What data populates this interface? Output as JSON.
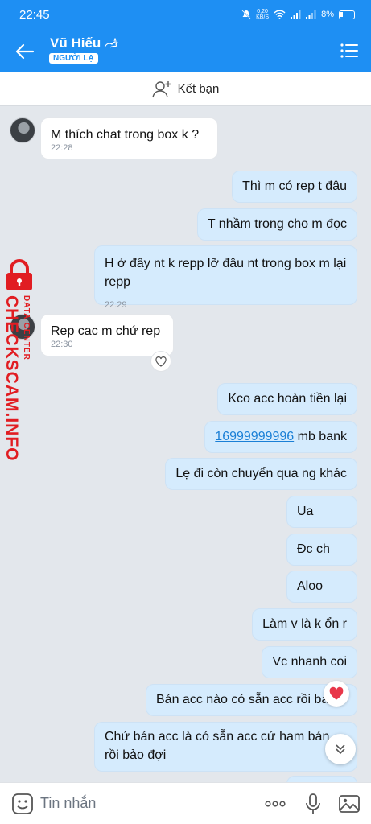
{
  "status": {
    "time": "22:45",
    "net_speed_top": "0,20",
    "net_speed_bottom": "KB/S",
    "battery": "8%"
  },
  "header": {
    "name": "Vũ Hiếu",
    "badge": "NGƯỜI LẠ",
    "add_friend": "Kết bạn"
  },
  "messages": [
    {
      "side": "in",
      "text": "M thích chat trong box k ?",
      "time": "22:28"
    },
    {
      "side": "out",
      "text": "Thì m có rep t đâu"
    },
    {
      "side": "out",
      "text": "T nhầm trong cho m đọc"
    },
    {
      "side": "out",
      "text": "H ở đây nt k repp lỡ đâu nt trong box m lại repp",
      "time": "22:29"
    },
    {
      "side": "in",
      "text": "Rep cac m chứ rep",
      "time": "22:30"
    },
    {
      "side": "out",
      "text": "Kco acc hoàn tiền lại"
    },
    {
      "side": "out",
      "link": "16999999996",
      "text": " mb bank"
    },
    {
      "side": "out",
      "text": "Lẹ đi còn chuyển qua ng khác"
    },
    {
      "side": "out",
      "text": "Ua"
    },
    {
      "side": "out",
      "text": "Đc ch"
    },
    {
      "side": "out",
      "text": "Aloo"
    },
    {
      "side": "out",
      "text": "Làm v là k ổn r"
    },
    {
      "side": "out",
      "text": "Vc nhanh coi"
    },
    {
      "side": "out",
      "text": "Bán acc nào có sẵn acc rồi bán"
    },
    {
      "side": "out",
      "text": "Chứ bán acc là có sẵn acc cứ ham bán rồi bảo đợi"
    }
  ],
  "watermark": {
    "main": "CHECKSCAM.INFO",
    "sub": "DATA CENTER"
  },
  "input": {
    "placeholder": "Tin nhắn"
  },
  "colors": {
    "header_blue": "#1e8ff3",
    "outgoing_bubble": "#d5ebfd",
    "incoming_bubble": "#ffffff",
    "watermark_red": "#e11d22"
  }
}
